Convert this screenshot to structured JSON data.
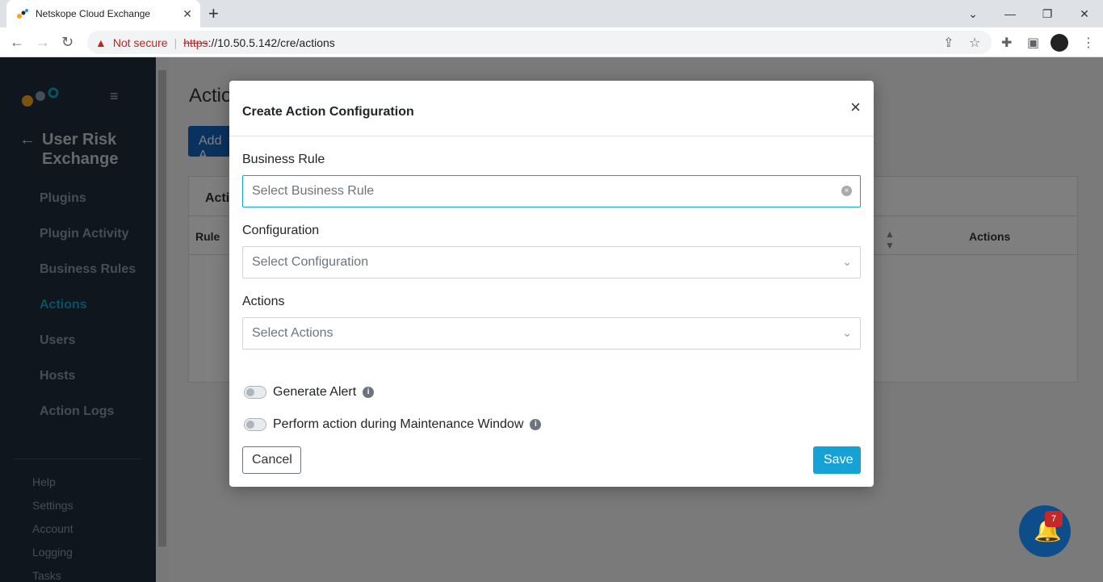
{
  "browser": {
    "tab_title": "Netskope Cloud Exchange",
    "not_secure": "Not secure",
    "url_scheme": "https",
    "url_rest": "://10.50.5.142/cre/actions"
  },
  "sidebar": {
    "back_title": "User Risk Exchange",
    "items": [
      {
        "label": "Plugins"
      },
      {
        "label": "Plugin Activity"
      },
      {
        "label": "Business Rules"
      },
      {
        "label": "Actions",
        "active": true
      },
      {
        "label": "Users"
      },
      {
        "label": "Hosts"
      },
      {
        "label": "Action Logs"
      }
    ],
    "sub_items": [
      {
        "label": "Help"
      },
      {
        "label": "Settings"
      },
      {
        "label": "Account"
      },
      {
        "label": "Logging"
      },
      {
        "label": "Tasks"
      }
    ]
  },
  "page": {
    "title": "Actio",
    "add_button": "Add A",
    "card_header": "Actio",
    "col_rule": "Rule",
    "col_actions": "Actions"
  },
  "modal": {
    "title": "Create Action Configuration",
    "business_rule_label": "Business Rule",
    "business_rule_placeholder": "Select Business Rule",
    "configuration_label": "Configuration",
    "configuration_placeholder": "Select Configuration",
    "actions_label": "Actions",
    "actions_placeholder": "Select Actions",
    "generate_alert_label": "Generate Alert",
    "maintenance_label": "Perform action during Maintenance Window",
    "cancel_label": "Cancel",
    "save_label": "Save"
  },
  "notifications": {
    "count": "7"
  },
  "colors": {
    "sidebar_bg": "#1f2d3a",
    "accent": "#14a3c7",
    "save_button": "#17a2d6"
  }
}
